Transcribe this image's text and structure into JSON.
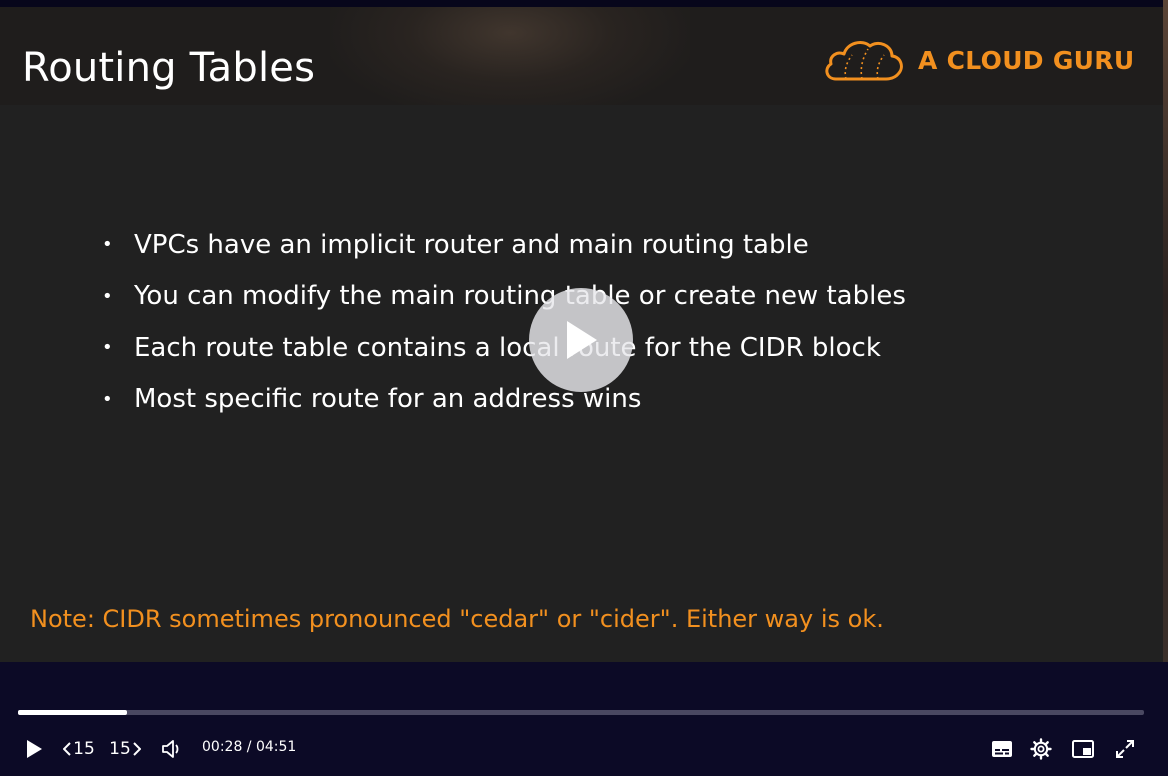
{
  "slide": {
    "title": "Routing Tables",
    "brand": "A CLOUD GURU",
    "bullets": [
      "VPCs have an implicit router and main routing table",
      "You can modify the main routing table or create new tables",
      "Each route table contains a local route for the CIDR block",
      "Most specific route for an address wins"
    ],
    "note": "Note: CIDR sometimes pronounced \"cedar\" or \"cider\".  Either way is ok."
  },
  "player": {
    "current_time": "00:28",
    "duration": "04:51",
    "time_display": "00:28 / 04:51",
    "progress_fraction": 0.097,
    "rewind_label": "15",
    "forward_label": "15",
    "icons": {
      "big_play": "play-icon",
      "play": "play-icon",
      "rewind": "rewind-15-icon",
      "forward": "forward-15-icon",
      "volume": "volume-icon",
      "captions": "captions-icon",
      "settings": "gear-icon",
      "pip": "picture-in-picture-icon",
      "fullscreen": "fullscreen-icon"
    }
  },
  "colors": {
    "accent_orange": "#f2901f",
    "slide_background": "#212121",
    "player_background": "#0c0a26"
  }
}
